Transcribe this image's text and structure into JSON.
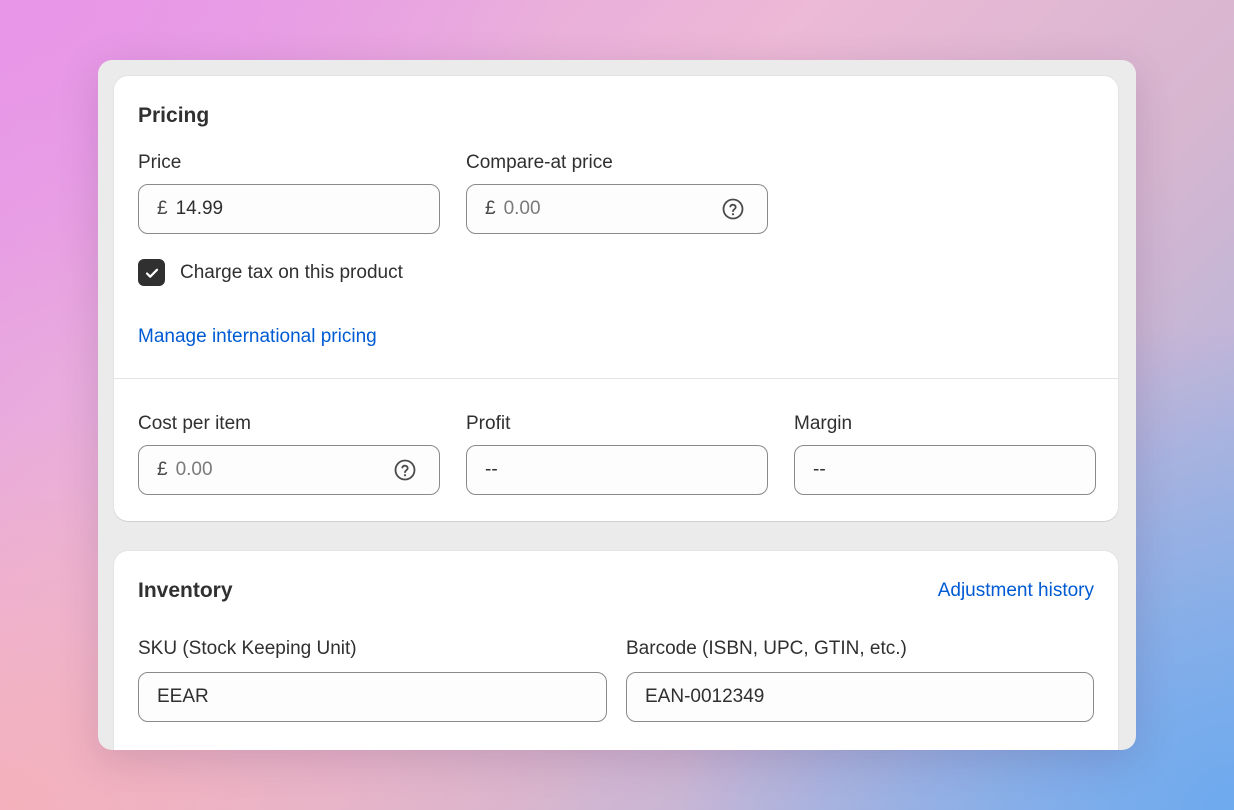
{
  "pricing": {
    "title": "Pricing",
    "price": {
      "label": "Price",
      "currency": "£",
      "value": "14.99"
    },
    "compare_at": {
      "label": "Compare-at price",
      "currency": "£",
      "placeholder": "0.00"
    },
    "charge_tax": {
      "label": "Charge tax on this product",
      "checked": true
    },
    "international_link": "Manage international pricing",
    "cost_per_item": {
      "label": "Cost per item",
      "currency": "£",
      "placeholder": "0.00"
    },
    "profit": {
      "label": "Profit",
      "value": "--"
    },
    "margin": {
      "label": "Margin",
      "value": "--"
    }
  },
  "inventory": {
    "title": "Inventory",
    "adjustment_link": "Adjustment history",
    "sku": {
      "label": "SKU (Stock Keeping Unit)",
      "value": "EEAR"
    },
    "barcode": {
      "label": "Barcode (ISBN, UPC, GTIN, etc.)",
      "value": "EAN-0012349"
    }
  },
  "colors": {
    "link": "#005bd3",
    "text": "#303030",
    "checkbox": "#303030"
  },
  "icons": [
    "question-circle-icon",
    "checkmark-icon"
  ]
}
